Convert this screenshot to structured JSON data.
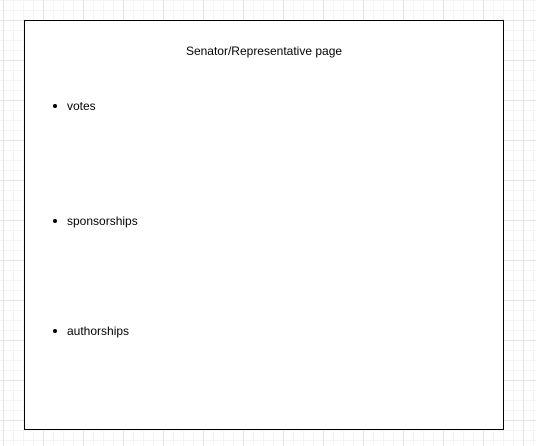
{
  "page": {
    "title": "Senator/Representative page",
    "items": [
      {
        "label": "votes"
      },
      {
        "label": "sponsorships"
      },
      {
        "label": "authorships"
      }
    ]
  }
}
